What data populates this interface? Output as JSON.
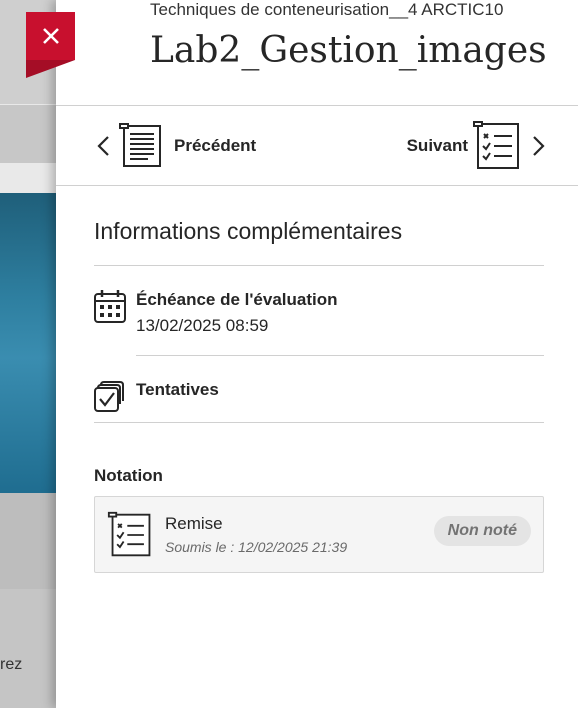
{
  "background": {
    "partial_text": "rez"
  },
  "header": {
    "course": "Techniques de conteneurisation__4 ARCTIC10",
    "title": "Lab2_Gestion_images"
  },
  "nav": {
    "previous_label": "Précédent",
    "next_label": "Suivant"
  },
  "details": {
    "section_title": "Informations complémentaires",
    "due_label": "Échéance de l'évaluation",
    "due_value": "13/02/2025 08:59",
    "attempts_label": "Tentatives"
  },
  "grading": {
    "title": "Notation",
    "item_name": "Remise",
    "item_sub": "Soumis le : 12/02/2025 21:39",
    "status": "Non noté"
  },
  "colors": {
    "close_button": "#c8102e",
    "text": "#262626"
  },
  "icons": [
    "close-icon",
    "chevron-left-icon",
    "document-icon",
    "checklist-icon",
    "chevron-right-icon",
    "calendar-icon",
    "attempts-icon"
  ]
}
